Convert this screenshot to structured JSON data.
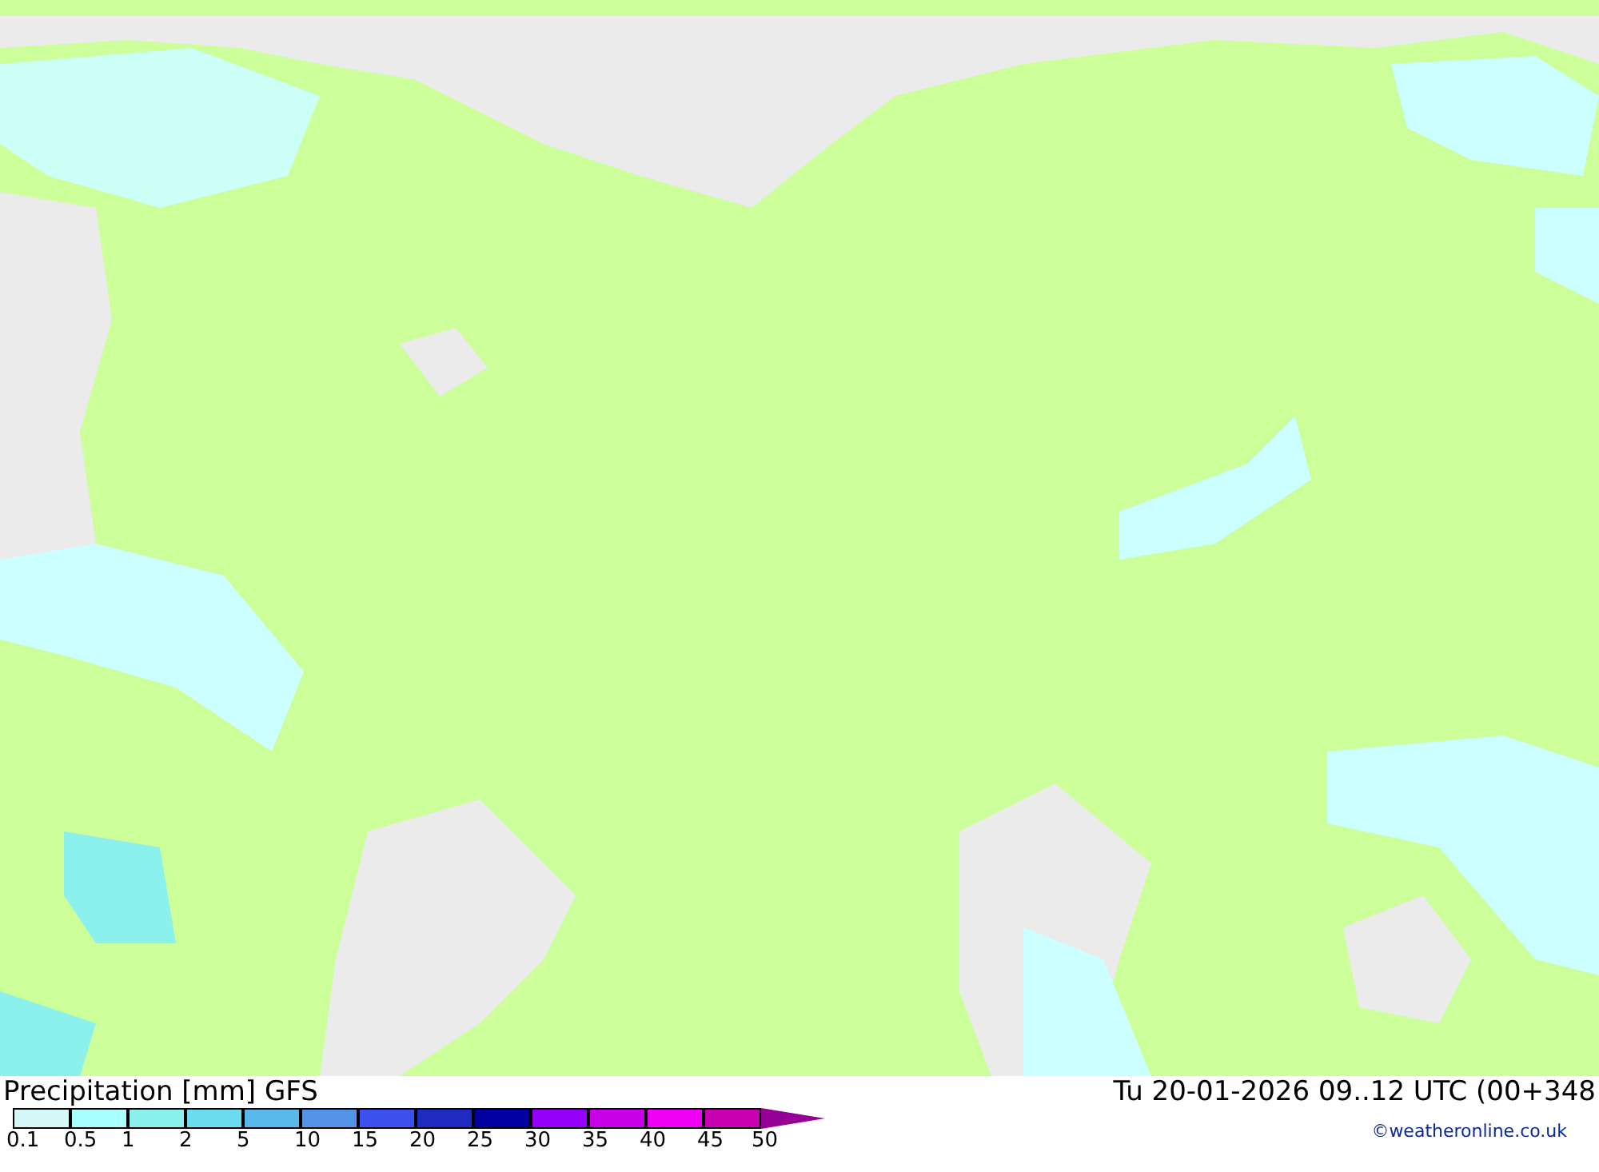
{
  "legend": {
    "title": "Precipitation [mm] GFS",
    "bins": [
      {
        "label": "0.1",
        "color": "#d4f8f8"
      },
      {
        "label": "0.5",
        "color": "#aaffff"
      },
      {
        "label": "1",
        "color": "#8cf0ec"
      },
      {
        "label": "2",
        "color": "#6adcee"
      },
      {
        "label": "5",
        "color": "#5ab8ea"
      },
      {
        "label": "10",
        "color": "#5494e8"
      },
      {
        "label": "15",
        "color": "#3c50f0"
      },
      {
        "label": "20",
        "color": "#1e2ac0"
      },
      {
        "label": "25",
        "color": "#0000a0"
      },
      {
        "label": "30",
        "color": "#9600f8"
      },
      {
        "label": "35",
        "color": "#c800e8"
      },
      {
        "label": "40",
        "color": "#f000f4"
      },
      {
        "label": "45",
        "color": "#c800b4"
      }
    ],
    "end_label": "50",
    "arrow": {
      "color": "#960096"
    }
  },
  "valid_time": "Tu 20-01-2026 09..12 UTC (00+348",
  "credit": "©weatheronline.co.uk"
}
